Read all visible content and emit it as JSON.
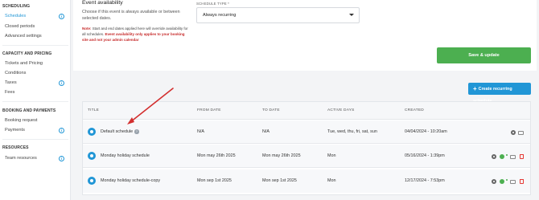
{
  "sidebar": {
    "sections": [
      {
        "title": "SCHEDULING",
        "items": [
          {
            "label": "Schedules",
            "active": true,
            "info": true
          },
          {
            "label": "Closed periods",
            "active": false,
            "info": false
          },
          {
            "label": "Advanced settings",
            "active": false,
            "info": false
          }
        ]
      },
      {
        "title": "CAPACITY AND PRICING",
        "items": [
          {
            "label": "Tickets and Pricing",
            "active": false,
            "info": false
          },
          {
            "label": "Conditions",
            "active": false,
            "info": false
          },
          {
            "label": "Taxes",
            "active": false,
            "info": true
          },
          {
            "label": "Fees",
            "active": false,
            "info": false
          }
        ]
      },
      {
        "title": "BOOKING AND PAYMENTS",
        "items": [
          {
            "label": "Booking request",
            "active": false,
            "info": false
          },
          {
            "label": "Payments",
            "active": false,
            "info": true
          }
        ]
      },
      {
        "title": "RESOURCES",
        "items": [
          {
            "label": "Team resources",
            "active": false,
            "info": true
          }
        ]
      }
    ]
  },
  "availability": {
    "title": "Event availability",
    "description": "Choose if this event is always available or between selected dates.",
    "note_prefix": "Note:",
    "note_body": " Start and end dates applied here will override availability for all schedules. ",
    "note_warning": "Event availability only applies to your booking site and not your admin calendar",
    "schedule_type_label": "SCHEDULE TYPE *",
    "schedule_type_value": "Always recurring"
  },
  "buttons": {
    "save": "Save & update",
    "create_plus": "+",
    "create": "Create recurring schedule"
  },
  "table": {
    "headers": {
      "title": "TITLE",
      "from": "FROM DATE",
      "to": "TO DATE",
      "days": "ACTIVE DAYS",
      "created": "CREATED"
    },
    "rows": [
      {
        "title": "Default schedule",
        "from": "N/A",
        "to": "N/A",
        "days": "Tue, wed, thu, fri, sat, sun",
        "created": "04/04/2024 - 10:20am",
        "has_info": true,
        "deletable": false
      },
      {
        "title": "Monday holiday schedule",
        "from": "Mon may 26th 2025",
        "to": "Mon may 26th 2025",
        "days": "Mon",
        "created": "05/16/2024 - 1:39pm",
        "has_info": false,
        "deletable": true
      },
      {
        "title": "Monday holiday schedule-copy",
        "from": "Mon sep 1st 2025",
        "to": "Mon sep 1st 2025",
        "days": "Mon",
        "created": "12/17/2024 - 7:53pm",
        "has_info": false,
        "deletable": true
      }
    ]
  },
  "colors": {
    "accent": "#2196d6",
    "save": "#4caf50",
    "warning": "#c62828",
    "annotation_arrow": "#d32f2f"
  }
}
